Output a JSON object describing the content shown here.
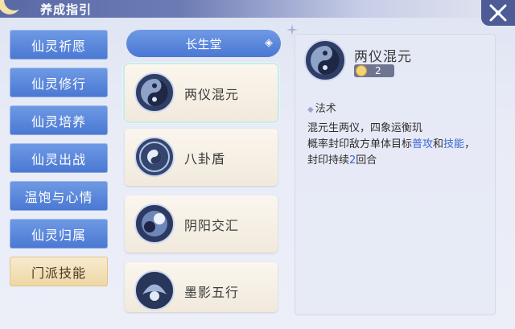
{
  "header": {
    "title": "养成指引"
  },
  "categories": [
    {
      "label": "仙灵祈愿",
      "active": false
    },
    {
      "label": "仙灵修行",
      "active": false
    },
    {
      "label": "仙灵培养",
      "active": false
    },
    {
      "label": "仙灵出战",
      "active": false
    },
    {
      "label": "温饱与心情",
      "active": false
    },
    {
      "label": "仙灵归属",
      "active": false
    },
    {
      "label": "门派技能",
      "active": true
    }
  ],
  "school_tab": {
    "label": "长生堂"
  },
  "skills": [
    {
      "name": "两仪混元",
      "selected": true
    },
    {
      "name": "八卦盾",
      "selected": false
    },
    {
      "name": "阴阳交汇",
      "selected": false
    },
    {
      "name": "墨影五行",
      "selected": false
    }
  ],
  "detail": {
    "name": "两仪混元",
    "level": "2",
    "type": "法术",
    "line1": "混元生两仪，四象运衡玑",
    "line2_pre": "概率封印敌方单体目标",
    "line2_hl1": "普攻",
    "line2_mid": "和",
    "line2_hl2": "技能",
    "line2_post": "，",
    "line3_pre": "封印持续",
    "line3_hl": "2",
    "line3_post": "回合"
  },
  "colors": {
    "accent_blue": "#4a78d3",
    "highlight_text": "#3b66d6",
    "active_tab": "#eed7a4"
  }
}
